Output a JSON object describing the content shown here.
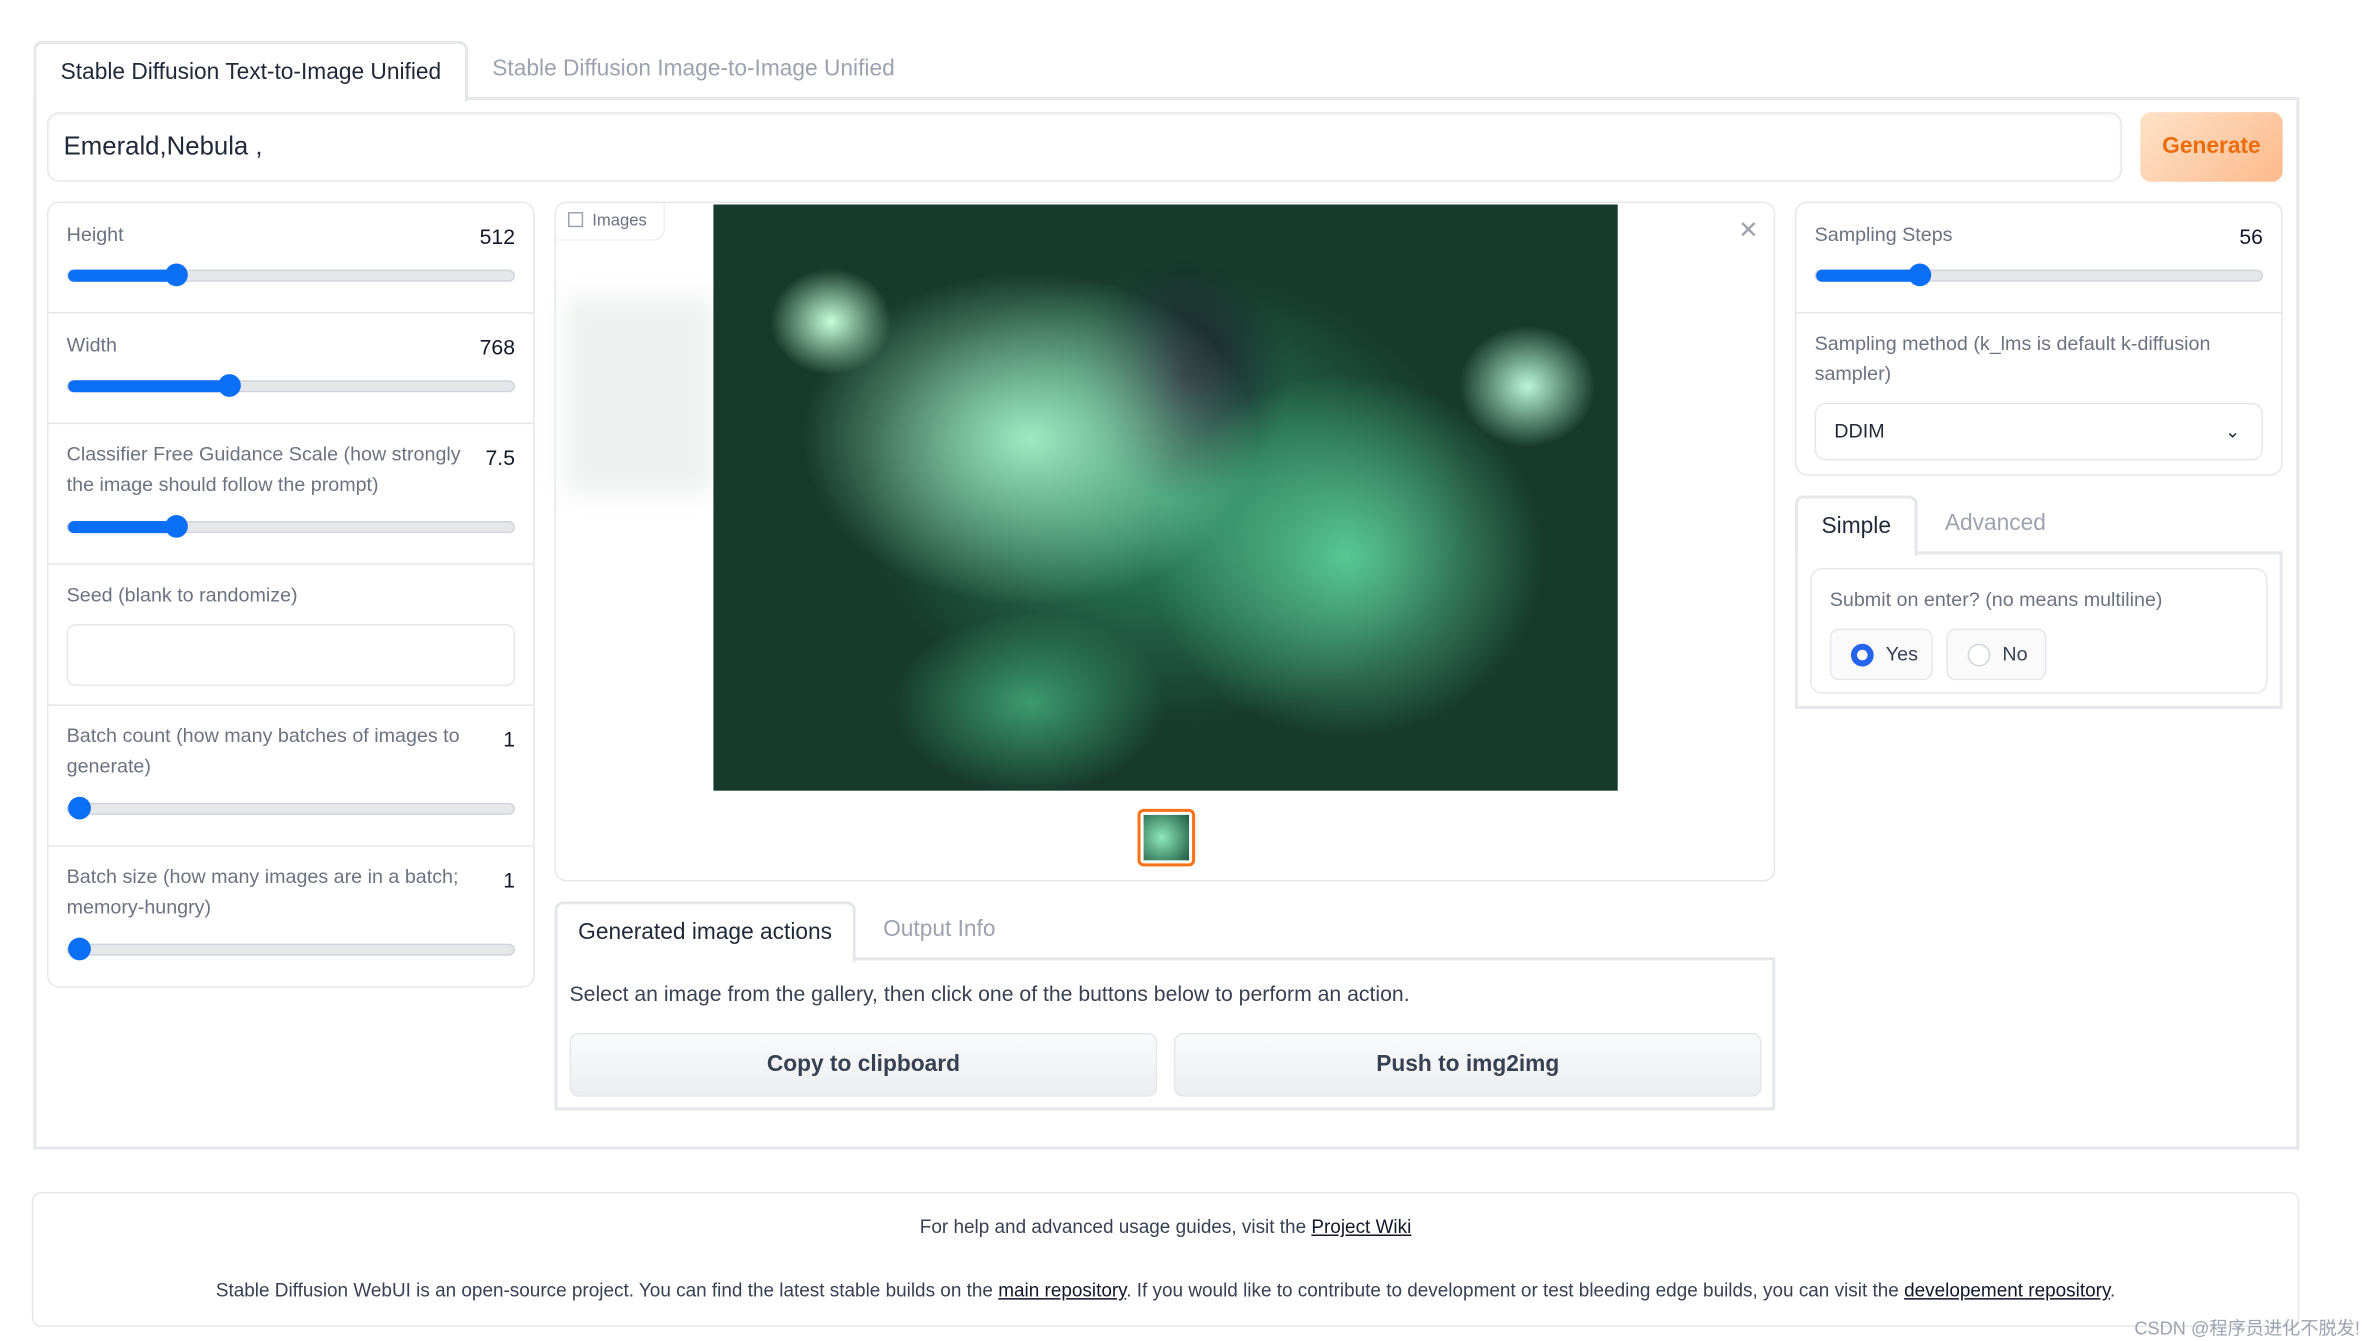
{
  "tabs": [
    {
      "label": "Stable Diffusion Text-to-Image Unified",
      "active": true
    },
    {
      "label": "Stable Diffusion Image-to-Image Unified",
      "active": false
    }
  ],
  "prompt": {
    "value": "Emerald,Nebula ,"
  },
  "generate_label": "Generate",
  "accent_color": "#f97316",
  "left": {
    "height": {
      "label": "Height",
      "value": "512",
      "fill_fraction": 0.24
    },
    "width": {
      "label": "Width",
      "value": "768",
      "fill_fraction": 0.36
    },
    "cfg": {
      "label": "Classifier Free Guidance Scale (how strongly the image should follow the prompt)",
      "value": "7.5",
      "fill_fraction": 0.24
    },
    "seed": {
      "label": "Seed (blank to randomize)",
      "value": ""
    },
    "batch_count": {
      "label": "Batch count (how many batches of images to generate)",
      "value": "1",
      "fill_fraction": 0
    },
    "batch_size": {
      "label": "Batch size (how many images are in a batch; memory-hungry)",
      "value": "1",
      "fill_fraction": 0
    }
  },
  "gallery": {
    "label": "Images",
    "icon": "image-icon",
    "close_icon": "close-icon"
  },
  "actions": {
    "tabs": [
      {
        "label": "Generated image actions",
        "active": true
      },
      {
        "label": "Output Info",
        "active": false
      }
    ],
    "instructions": "Select an image from the gallery, then click one of the buttons below to perform an action.",
    "copy_label": "Copy to clipboard",
    "push_label": "Push to img2img"
  },
  "right": {
    "steps": {
      "label": "Sampling Steps",
      "value": "56",
      "fill_fraction": 0.23
    },
    "method": {
      "label": "Sampling method (k_lms is default k-diffusion sampler)",
      "value": "DDIM"
    },
    "mode_tabs": [
      {
        "label": "Simple",
        "active": true
      },
      {
        "label": "Advanced",
        "active": false
      }
    ],
    "submit": {
      "label": "Submit on enter? (no means multiline)",
      "options": [
        "Yes",
        "No"
      ],
      "selected": "Yes"
    }
  },
  "footer": {
    "line1_prefix": "For help and advanced usage guides, visit the ",
    "line1_link": "Project Wiki",
    "line2_a": "Stable Diffusion WebUI is an open-source project. You can find the latest stable builds on the ",
    "line2_link1": "main repository",
    "line2_b": ". If you would like to contribute to development or test bleeding edge builds, you can visit the ",
    "line2_link2": "developement repository",
    "line2_c": "."
  },
  "watermark": "CSDN @程序员进化不脱发!"
}
